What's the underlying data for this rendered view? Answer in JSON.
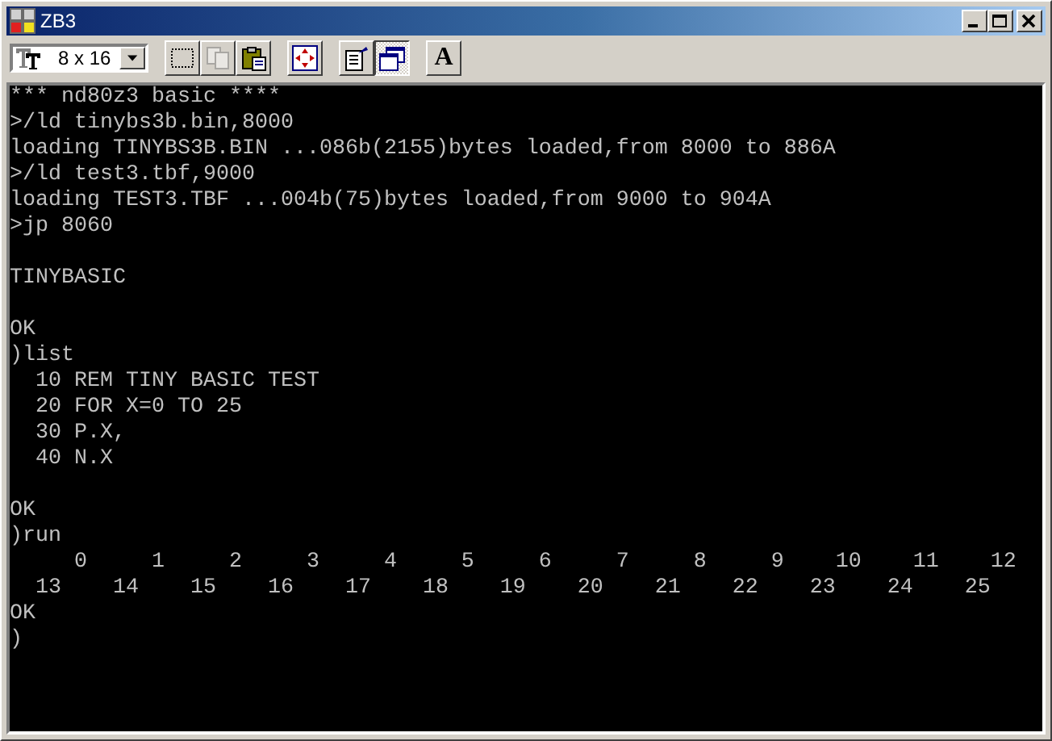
{
  "window": {
    "title": "ZB3"
  },
  "toolbar": {
    "font_size": "8 x 16",
    "buttons": [
      {
        "kind": "mark",
        "disabled": false,
        "selected": false
      },
      {
        "kind": "copy",
        "disabled": true,
        "selected": false
      },
      {
        "kind": "paste",
        "disabled": false,
        "selected": false
      },
      {
        "kind": "fullscreen",
        "disabled": false,
        "selected": false
      },
      {
        "kind": "properties",
        "disabled": false,
        "selected": false
      },
      {
        "kind": "background",
        "disabled": false,
        "selected": true
      },
      {
        "kind": "font",
        "disabled": false,
        "selected": false,
        "label": "A"
      }
    ]
  },
  "console": {
    "blocks": [
      [
        "*** nd80z3 basic ****",
        ">/ld tinybs3b.bin,8000",
        "loading TINYBS3B.BIN ...086b(2155)bytes loaded,from 8000 to 886A",
        ">/ld test3.tbf,9000",
        "loading TEST3.TBF ...004b(75)bytes loaded,from 9000 to 904A",
        ">jp 8060"
      ],
      [
        "TINYBASIC"
      ],
      [
        "OK",
        ")list",
        "  10 REM TINY BASIC TEST",
        "  20 FOR X=0 TO 25",
        "  30 P.X,",
        "  40 N.X"
      ],
      [
        "OK",
        ")run",
        "     0     1     2     3     4     5     6     7     8     9    10    11    12",
        "  13    14    15    16    17    18    19    20    21    22    23    24    25",
        "OK",
        ")"
      ]
    ]
  }
}
